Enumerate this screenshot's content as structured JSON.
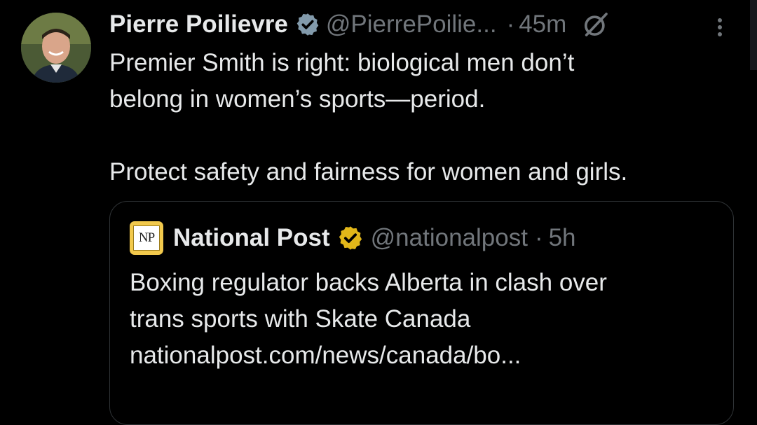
{
  "tweet": {
    "author_name": "Pierre Poilievre",
    "author_handle": "@PierrePoilie...",
    "separator": "·",
    "time": "45m",
    "verified_color": "#829aab",
    "avatar_icon": "avatar-photo",
    "text_line1": "Premier Smith is right: biological men don’t",
    "text_line2": "belong in women’s sports—period.",
    "text_line3": "Protect safety and fairness for women and girls."
  },
  "quote": {
    "author_name": "National Post",
    "logo_text": "NP",
    "author_handle": "@nationalpost",
    "separator": "·",
    "time": "5h",
    "verified_color": "#e2b719",
    "text_line1": "Boxing regulator backs Alberta in clash over",
    "text_line2": "trans sports with Skate Canada",
    "text_line3": "nationalpost.com/news/canada/bo..."
  },
  "icons": {
    "grok": "grok-icon",
    "more": "more-options-icon",
    "verified": "verified-badge-icon"
  },
  "colors": {
    "background": "#000000",
    "text": "#e7e9ea",
    "muted": "#71767b",
    "border": "#2f3336"
  }
}
